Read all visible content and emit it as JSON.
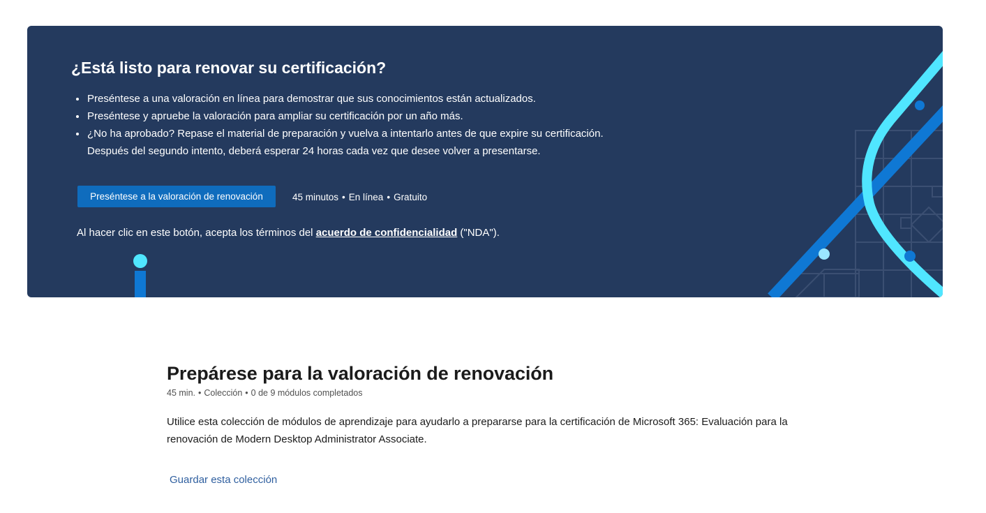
{
  "hero": {
    "title": "¿Está listo para renovar su certificación?",
    "bullets": [
      "Preséntese a una valoración en línea para demostrar que sus conocimientos están actualizados.",
      "Preséntese y apruebe la valoración para ampliar su certificación por un año más.",
      "¿No ha aprobado? Repase el material de preparación y vuelva a intentarlo antes de que expire su certificación.",
      "Después del segundo intento, deberá esperar 24 horas cada vez que desee volver a presentarse."
    ],
    "button_label": "Preséntese a la valoración de renovación",
    "meta": {
      "duration": "45 minutos",
      "mode": "En línea",
      "price": "Gratuito",
      "separator": "•"
    },
    "nda": {
      "prefix": "Al hacer clic en este botón, acepta los términos del ",
      "link_label": "acuerdo de confidencialidad",
      "suffix": " (\"NDA\")."
    },
    "colors": {
      "background": "#243a5e",
      "button": "#0f6cbd",
      "accent_light": "#50e6ff",
      "accent_blue": "#0f78d4"
    },
    "decor_icons": [
      "pin-graphic",
      "transit-lines-graphic"
    ]
  },
  "collection": {
    "title": "Prepárese para la valoración de renovación",
    "meta": {
      "duration": "45 min.",
      "type": "Colección",
      "progress": "0 de 9 módulos completados",
      "separator": "•"
    },
    "description": "Utilice esta colección de módulos de aprendizaje para ayudarlo a prepararse para la certificación de Microsoft 365: Evaluación para la renovación de Modern Desktop Administrator Associate.",
    "save_label": "Guardar esta colección"
  }
}
